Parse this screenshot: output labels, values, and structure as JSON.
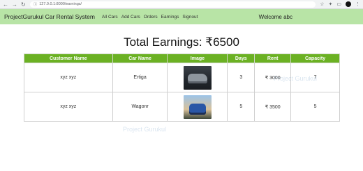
{
  "browser": {
    "back_icon": "back-arrow-icon",
    "url": "127.0.0.1:8000/earnings/"
  },
  "navbar": {
    "brand": "ProjectGurukul Car Rental System",
    "links": [
      "All Cars",
      "Add Cars",
      "Orders",
      "Earnings",
      "Signout"
    ],
    "welcome": "Welcome abc"
  },
  "page": {
    "title": "Total Earnings: ₹6500"
  },
  "table": {
    "headers": [
      "Customer Name",
      "Car Name",
      "Image",
      "Days",
      "Rent",
      "Capacity"
    ],
    "rows": [
      {
        "customer": "xyz xyz",
        "car": "Ertiga",
        "image": "car-photo",
        "days": "3",
        "rent": "₹ 3000",
        "capacity": "7"
      },
      {
        "customer": "xyz xyz",
        "car": "Wagonr",
        "image": "car-photo",
        "days": "5",
        "rent": "₹ 3500",
        "capacity": "5"
      }
    ]
  },
  "watermark": "Project Gurukul",
  "colors": {
    "navbar": "#b8e4a6",
    "table_header": "#6bb123"
  }
}
